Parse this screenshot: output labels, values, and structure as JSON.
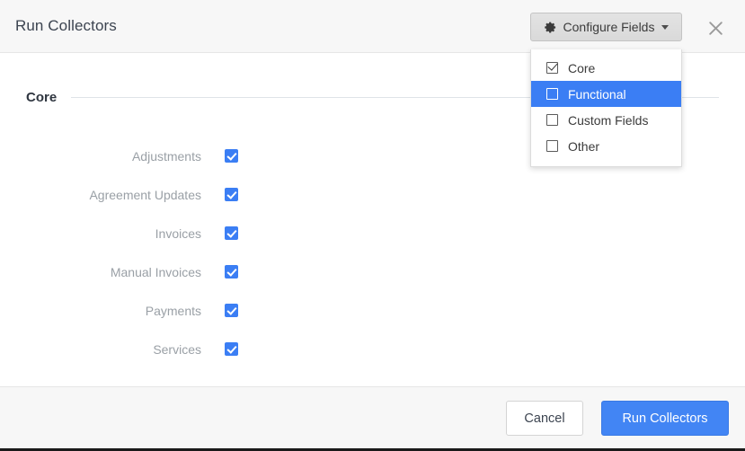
{
  "header": {
    "title": "Run Collectors",
    "close_icon": "close-icon",
    "configure_button": {
      "label": "Configure Fields",
      "icon": "gear-icon",
      "caret_icon": "chevron-down-icon"
    }
  },
  "dropdown": {
    "items": [
      {
        "label": "Core",
        "checked": true,
        "selected": false
      },
      {
        "label": "Functional",
        "checked": false,
        "selected": true
      },
      {
        "label": "Custom Fields",
        "checked": false,
        "selected": false
      },
      {
        "label": "Other",
        "checked": false,
        "selected": false
      }
    ]
  },
  "body": {
    "section": {
      "title": "Core",
      "fields": [
        {
          "label": "Adjustments",
          "checked": true
        },
        {
          "label": "Agreement Updates",
          "checked": true
        },
        {
          "label": "Invoices",
          "checked": true
        },
        {
          "label": "Manual Invoices",
          "checked": true
        },
        {
          "label": "Payments",
          "checked": true
        },
        {
          "label": "Services",
          "checked": true
        }
      ]
    }
  },
  "footer": {
    "cancel_label": "Cancel",
    "submit_label": "Run Collectors"
  },
  "colors": {
    "accent": "#4285f4",
    "highlight": "#3b7ef4",
    "header_bg": "#f7f7f7",
    "label_text": "#9aa0a6",
    "title_text": "#3c4450"
  }
}
